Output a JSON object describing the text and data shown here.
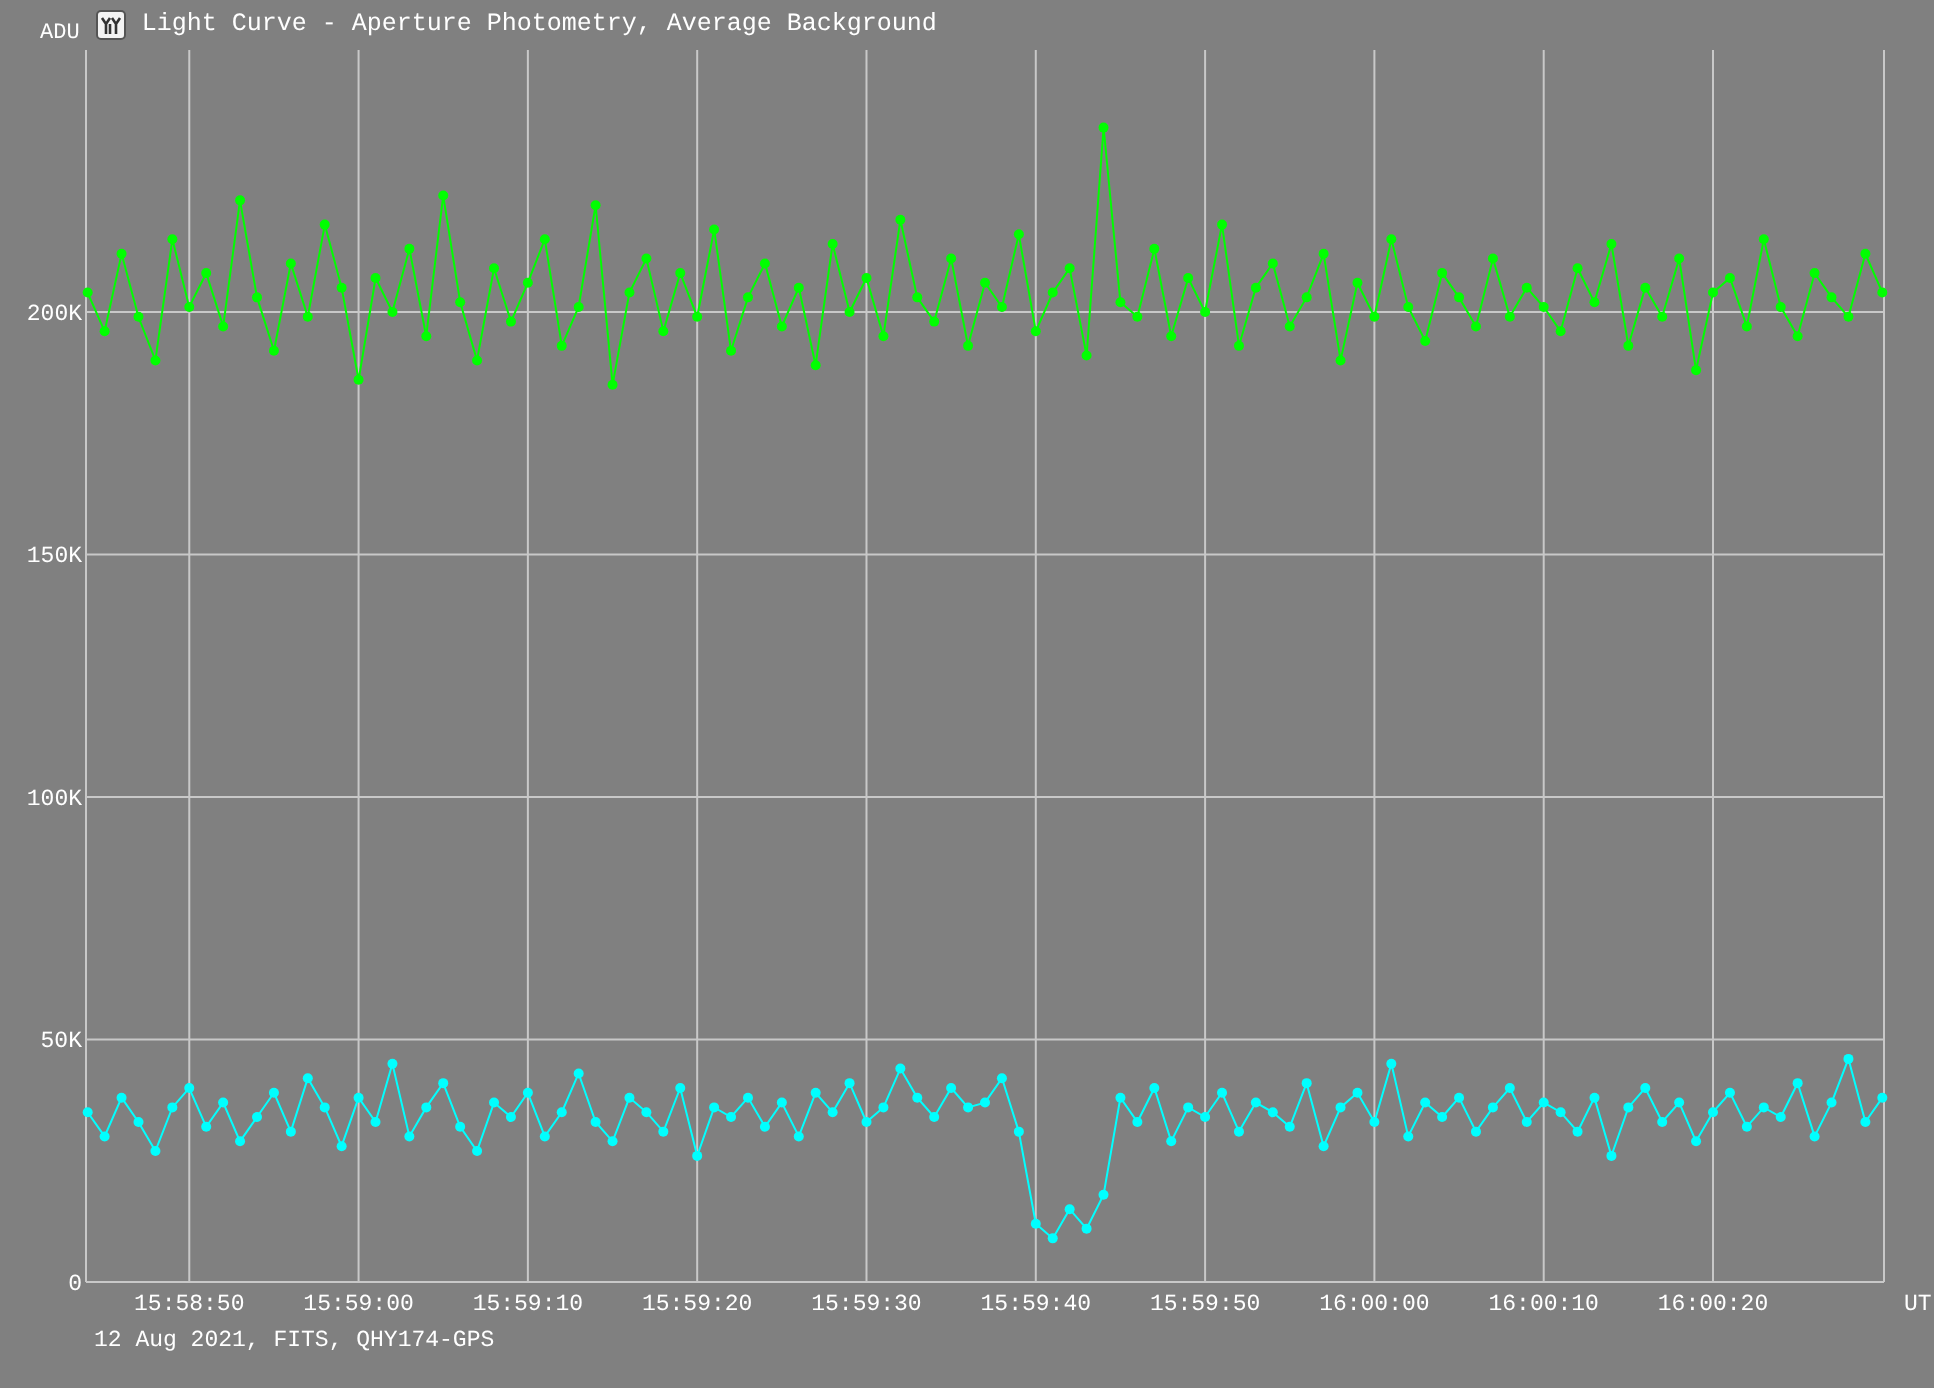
{
  "window": {
    "title": "Light Curve - Aperture Photometry, Average Background"
  },
  "chart": {
    "chart_data": {
      "type": "line",
      "ylabel": "ADU",
      "xlabel": "UT",
      "categories": [
        null,
        null,
        null,
        null,
        null,
        null,
        "15:58:50",
        null,
        null,
        null,
        null,
        null,
        null,
        null,
        null,
        null,
        "15:59:00",
        null,
        null,
        null,
        null,
        null,
        null,
        null,
        null,
        null,
        "15:59:10",
        null,
        null,
        null,
        null,
        null,
        null,
        null,
        null,
        null,
        "15:59:20",
        null,
        null,
        null,
        null,
        null,
        null,
        null,
        null,
        null,
        "15:59:30",
        null,
        null,
        null,
        null,
        null,
        null,
        null,
        null,
        null,
        "15:59:40",
        null,
        null,
        null,
        null,
        null,
        null,
        null,
        null,
        null,
        "15:59:50",
        null,
        null,
        null,
        null,
        null,
        null,
        null,
        null,
        null,
        "16:00:00",
        null,
        null,
        null,
        null,
        null,
        null,
        null,
        null,
        null,
        "16:00:10",
        null,
        null,
        null,
        null,
        null,
        null,
        null,
        null,
        null,
        "16:00:20",
        null,
        null,
        null,
        null,
        null,
        null,
        null,
        null,
        null,
        null
      ],
      "series": [
        {
          "color": "#00ff00",
          "marker": true,
          "values": [
            204000,
            196000,
            212000,
            199000,
            190000,
            215000,
            201000,
            208000,
            197000,
            223000,
            203000,
            192000,
            210000,
            199000,
            218000,
            205000,
            186000,
            207000,
            200000,
            213000,
            195000,
            224000,
            202000,
            190000,
            209000,
            198000,
            206000,
            215000,
            193000,
            201000,
            222000,
            185000,
            204000,
            211000,
            196000,
            208000,
            199000,
            217000,
            192000,
            203000,
            210000,
            197000,
            205000,
            189000,
            214000,
            200000,
            207000,
            195000,
            219000,
            203000,
            198000,
            211000,
            193000,
            206000,
            201000,
            216000,
            196000,
            204000,
            209000,
            191000,
            238000,
            202000,
            199000,
            213000,
            195000,
            207000,
            200000,
            218000,
            193000,
            205000,
            210000,
            197000,
            203000,
            212000,
            190000,
            206000,
            199000,
            215000,
            201000,
            194000,
            208000,
            203000,
            197000,
            211000,
            199000,
            205000,
            201000,
            196000,
            209000,
            202000,
            214000,
            193000,
            205000,
            199000,
            211000,
            188000,
            204000,
            207000,
            197000,
            215000,
            201000,
            195000,
            208000,
            203000,
            199000,
            212000,
            204000
          ]
        },
        {
          "color": "#00ffff",
          "marker": true,
          "values": [
            35000,
            30000,
            38000,
            33000,
            27000,
            36000,
            40000,
            32000,
            37000,
            29000,
            34000,
            39000,
            31000,
            42000,
            36000,
            28000,
            38000,
            33000,
            45000,
            30000,
            36000,
            41000,
            32000,
            27000,
            37000,
            34000,
            39000,
            30000,
            35000,
            43000,
            33000,
            29000,
            38000,
            35000,
            31000,
            40000,
            26000,
            36000,
            34000,
            38000,
            32000,
            37000,
            30000,
            39000,
            35000,
            41000,
            33000,
            36000,
            44000,
            38000,
            34000,
            40000,
            36000,
            37000,
            42000,
            31000,
            12000,
            9000,
            15000,
            11000,
            18000,
            38000,
            33000,
            40000,
            29000,
            36000,
            34000,
            39000,
            31000,
            37000,
            35000,
            32000,
            41000,
            28000,
            36000,
            39000,
            33000,
            45000,
            30000,
            37000,
            34000,
            38000,
            31000,
            36000,
            40000,
            33000,
            37000,
            35000,
            31000,
            38000,
            26000,
            36000,
            40000,
            33000,
            37000,
            29000,
            35000,
            39000,
            32000,
            36000,
            34000,
            41000,
            30000,
            37000,
            46000,
            33000,
            38000
          ]
        }
      ],
      "ylim": [
        0,
        254000
      ],
      "grid": true,
      "yticks": [
        {
          "value": 0,
          "label": "0"
        },
        {
          "value": 50000,
          "label": "50K"
        },
        {
          "value": 100000,
          "label": "100K"
        },
        {
          "value": 150000,
          "label": "150K"
        },
        {
          "value": 200000,
          "label": "200K"
        }
      ]
    }
  },
  "footer": "12 Aug 2021, FITS, QHY174-GPS"
}
